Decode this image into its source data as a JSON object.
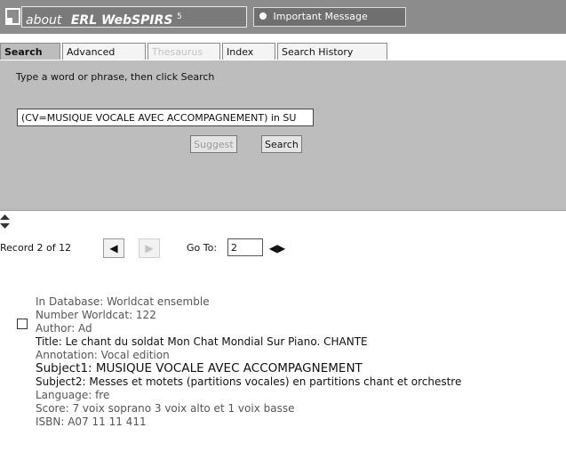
{
  "header": {
    "about": "about",
    "brand": "ERL WebSPIRS",
    "version": "5",
    "message": "Important Message"
  },
  "tabs": [
    {
      "label": "Search",
      "state": "active"
    },
    {
      "label": "Advanced",
      "state": "normal"
    },
    {
      "label": "Thesaurus",
      "state": "disabled"
    },
    {
      "label": "Index",
      "state": "normal"
    },
    {
      "label": "Search History",
      "state": "normal"
    }
  ],
  "search": {
    "prompt": "Type a word or phrase, then click Search",
    "query": "(CV=MUSIQUE VOCALE AVEC ACCOMPAGNEMENT) in SU",
    "suggest_label": "Suggest",
    "search_label": "Search"
  },
  "nav": {
    "records_label": "Record 2 of 12",
    "goto_label": "Go To:",
    "goto_value": "2"
  },
  "record": {
    "database": "In Database: Worldcat ensemble",
    "number": "Number Worldcat: 122",
    "author": "Author: Ad",
    "title": "Title: Le chant du soldat Mon Chat Mondial Sur Piano. CHANTE",
    "annotation": "Annotation: Vocal edition",
    "subject1": "Subject1: MUSIQUE VOCALE AVEC ACCOMPAGNEMENT",
    "subject2": "Subject2: Messes et motets (partitions vocales) en partitions chant et orchestre",
    "language": "Language: fre",
    "score": "Score: 7 voix soprano 3 voix alto et 1 voix basse",
    "isbn": "ISBN: A07 11 11 411"
  },
  "colors": {
    "topbar": "#8c8c8c",
    "panel": "#bdbdbd",
    "active_tab": "#bdbdbd"
  }
}
